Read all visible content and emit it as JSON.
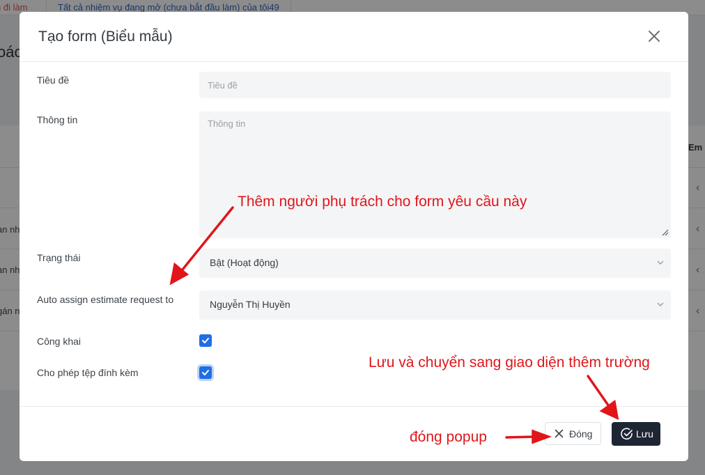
{
  "background": {
    "tab_partial": "g đi làm",
    "tab_open_tasks": "Tất cả nhiệm vụ đang mở (chưa bắt đầu làm) của tôi49",
    "heading_fragment": "oác",
    "row_fragments": [
      "àn nh",
      "àn nh",
      "gán n"
    ],
    "column_fragment": "Em"
  },
  "modal": {
    "title": "Tạo form (Biểu mẫu)",
    "fields": {
      "title_label": "Tiêu đề",
      "title_placeholder": "Tiêu đề",
      "info_label": "Thông tin",
      "info_placeholder": "Thông tin",
      "status_label": "Trạng thái",
      "status_value": "Bật (Hoạt động)",
      "assign_label": "Auto assign estimate request to",
      "assign_value": "Nguyễn Thị Huyền",
      "public_label": "Công khai",
      "public_checked": true,
      "attach_label": "Cho phép tệp đính kèm",
      "attach_checked": true
    },
    "footer": {
      "close_label": "Đóng",
      "save_label": "Lưu"
    }
  },
  "annotations": {
    "assign_note": "Thêm người phụ trách cho form yêu cầu này",
    "save_note": "Lưu và chuyển sang giao diện thêm trường",
    "close_note": "đóng popup",
    "color": "#e0161b"
  },
  "colors": {
    "accent": "#1f6fe5",
    "save_button": "#1e2533"
  }
}
